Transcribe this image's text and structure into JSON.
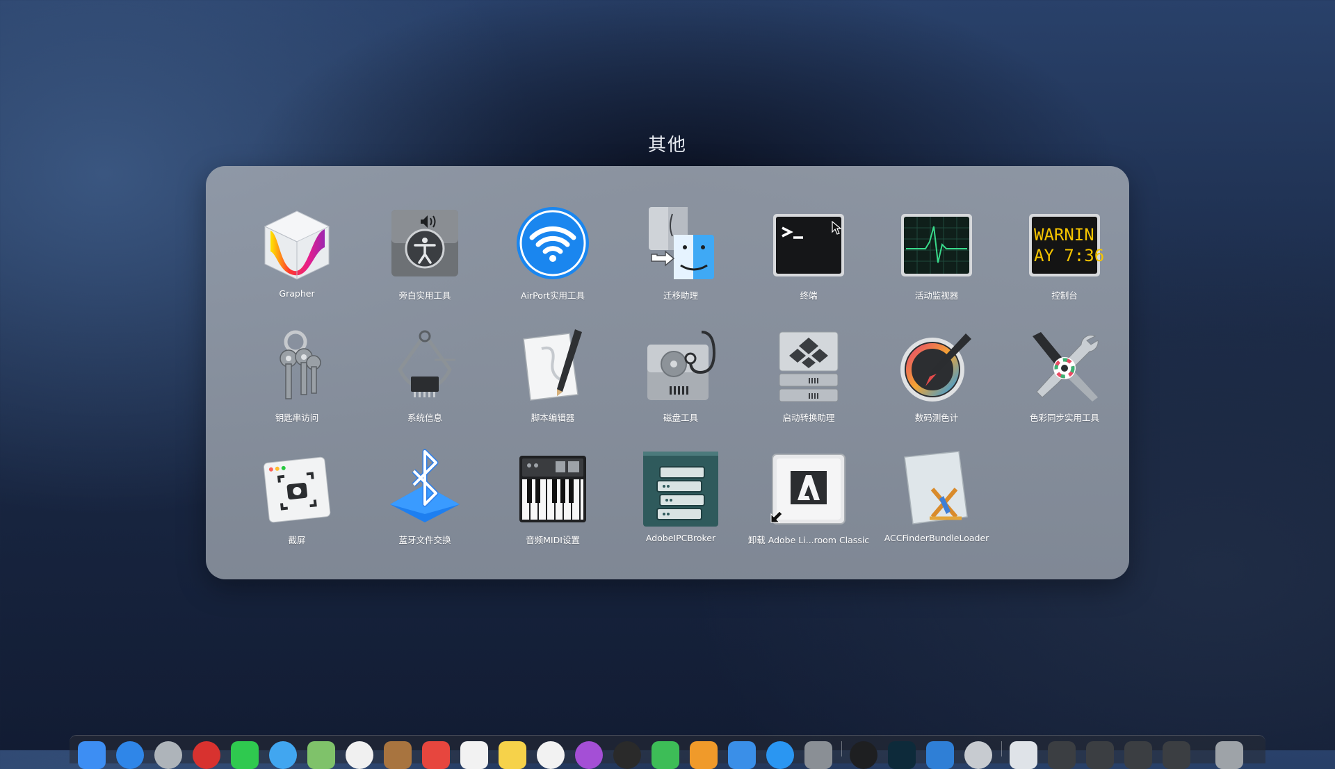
{
  "folder": {
    "title": "其他",
    "apps": [
      {
        "label": "Grapher",
        "icon": "grapher-icon"
      },
      {
        "label": "旁白实用工具",
        "icon": "voiceover-utility-icon"
      },
      {
        "label": "AirPort实用工具",
        "icon": "airport-utility-icon"
      },
      {
        "label": "迁移助理",
        "icon": "migration-assistant-icon"
      },
      {
        "label": "终端",
        "icon": "terminal-icon"
      },
      {
        "label": "活动监视器",
        "icon": "activity-monitor-icon"
      },
      {
        "label": "控制台",
        "icon": "console-icon",
        "icon_text": [
          "WARNIN",
          "AY 7:36"
        ]
      },
      {
        "label": "钥匙串访问",
        "icon": "keychain-access-icon"
      },
      {
        "label": "系统信息",
        "icon": "system-information-icon"
      },
      {
        "label": "脚本编辑器",
        "icon": "script-editor-icon"
      },
      {
        "label": "磁盘工具",
        "icon": "disk-utility-icon"
      },
      {
        "label": "启动转换助理",
        "icon": "boot-camp-assistant-icon"
      },
      {
        "label": "数码测色计",
        "icon": "digital-color-meter-icon"
      },
      {
        "label": "色彩同步实用工具",
        "icon": "colorsync-utility-icon"
      },
      {
        "label": "截屏",
        "icon": "screenshot-icon"
      },
      {
        "label": "蓝牙文件交换",
        "icon": "bluetooth-file-exchange-icon"
      },
      {
        "label": "音频MIDI设置",
        "icon": "audio-midi-setup-icon"
      },
      {
        "label": "AdobeIPCBroker",
        "icon": "adobe-ipc-broker-icon"
      },
      {
        "label": "卸载 Adobe Li...room Classic",
        "icon": "adobe-uninstaller-icon"
      },
      {
        "label": "ACCFinderBundleLoader",
        "icon": "acc-finder-bundle-loader-icon"
      }
    ]
  },
  "colors": {
    "accent_blue": "#1e8ef5",
    "panel": "#979fab",
    "console_text": "#f5c400"
  }
}
